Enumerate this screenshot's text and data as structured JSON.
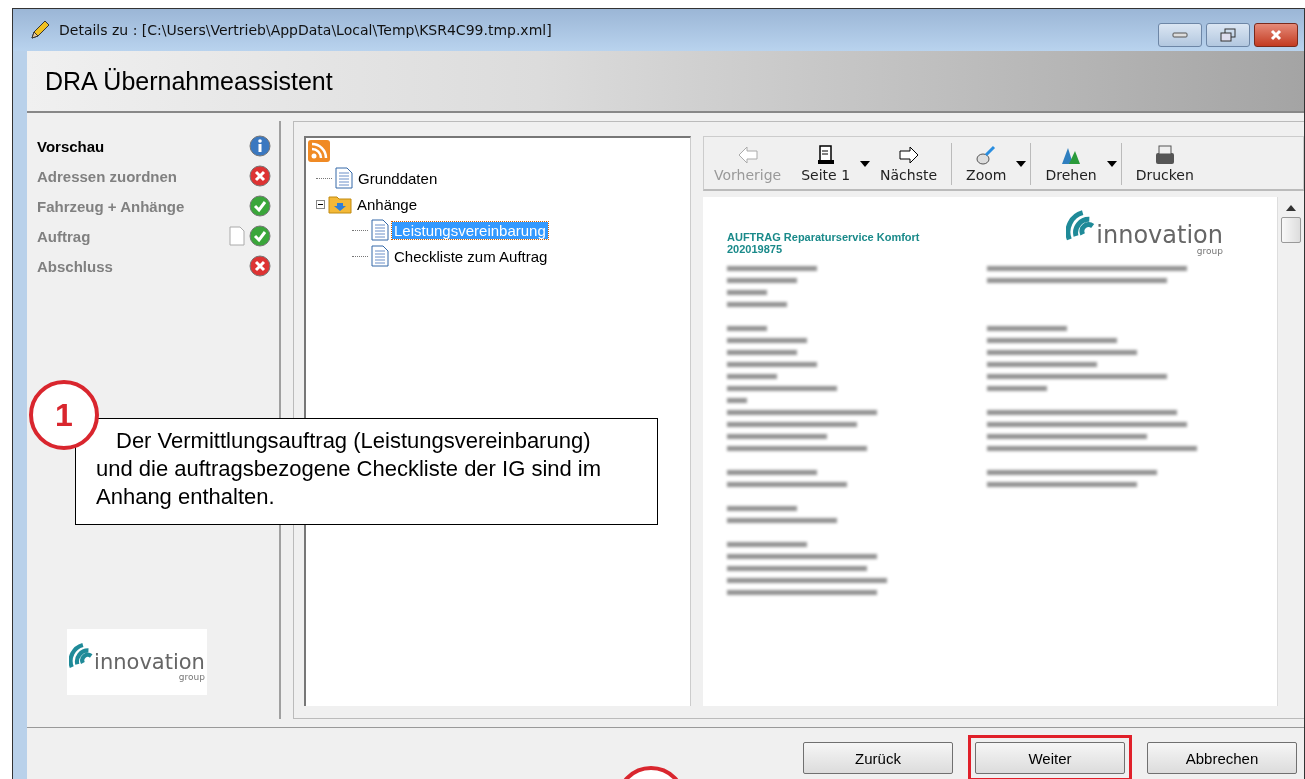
{
  "window": {
    "title": "Details zu : [C:\\Users\\Vertrieb\\AppData\\Local\\Temp\\KSR4C99.tmp.xml]"
  },
  "header": {
    "title": "DRA Übernahmeassistent"
  },
  "steps": [
    {
      "label": "Vorschau",
      "selected": true,
      "kind": "info",
      "has_document": false
    },
    {
      "label": "Adressen zuordnen",
      "selected": false,
      "kind": "error",
      "has_document": false
    },
    {
      "label": "Fahrzeug + Anhänge",
      "selected": false,
      "kind": "ok",
      "has_document": false
    },
    {
      "label": "Auftrag",
      "selected": false,
      "kind": "ok",
      "has_document": true
    },
    {
      "label": "Abschluss",
      "selected": false,
      "kind": "error",
      "has_document": false
    }
  ],
  "sidebar_logo": {
    "name": "innovation",
    "sub": "group"
  },
  "tree": {
    "children": [
      {
        "label": "Grunddaten",
        "kind": "document",
        "selected": false
      },
      {
        "label": "Anhänge",
        "kind": "folder",
        "expanded": true,
        "children": [
          {
            "label": "Leistungsvereinbarung",
            "kind": "document",
            "selected": true
          },
          {
            "label": "Checkliste zum Auftrag",
            "kind": "document",
            "selected": false
          }
        ]
      }
    ]
  },
  "toolbar": [
    {
      "label": "Vorherige",
      "disabled": true,
      "dropdown": false,
      "separator_after": false
    },
    {
      "label": "Seite 1",
      "disabled": false,
      "dropdown": true,
      "separator_after": false
    },
    {
      "label": "Nächste",
      "disabled": false,
      "dropdown": false,
      "separator_after": true
    },
    {
      "label": "Zoom",
      "disabled": false,
      "dropdown": true,
      "separator_after": true
    },
    {
      "label": "Drehen",
      "disabled": false,
      "dropdown": true,
      "separator_after": true
    },
    {
      "label": "Drucken",
      "disabled": false,
      "dropdown": false,
      "separator_after": false
    }
  ],
  "document": {
    "title": "AUFTRAG Reparaturservice Komfort",
    "number": "202019875",
    "logo": {
      "name": "innovation",
      "sub": "group"
    }
  },
  "callout": {
    "number": "1",
    "text": "Der Vermittlungsauftrag (Leistungsvereinbarung) und die auftragsbezogene Checkliste der IG sind im Anhang enthalten."
  },
  "buttons": [
    {
      "label": "Zurück",
      "highlighted": false
    },
    {
      "label": "Weiter",
      "highlighted": true
    },
    {
      "label": "Abbrechen",
      "highlighted": false
    }
  ]
}
